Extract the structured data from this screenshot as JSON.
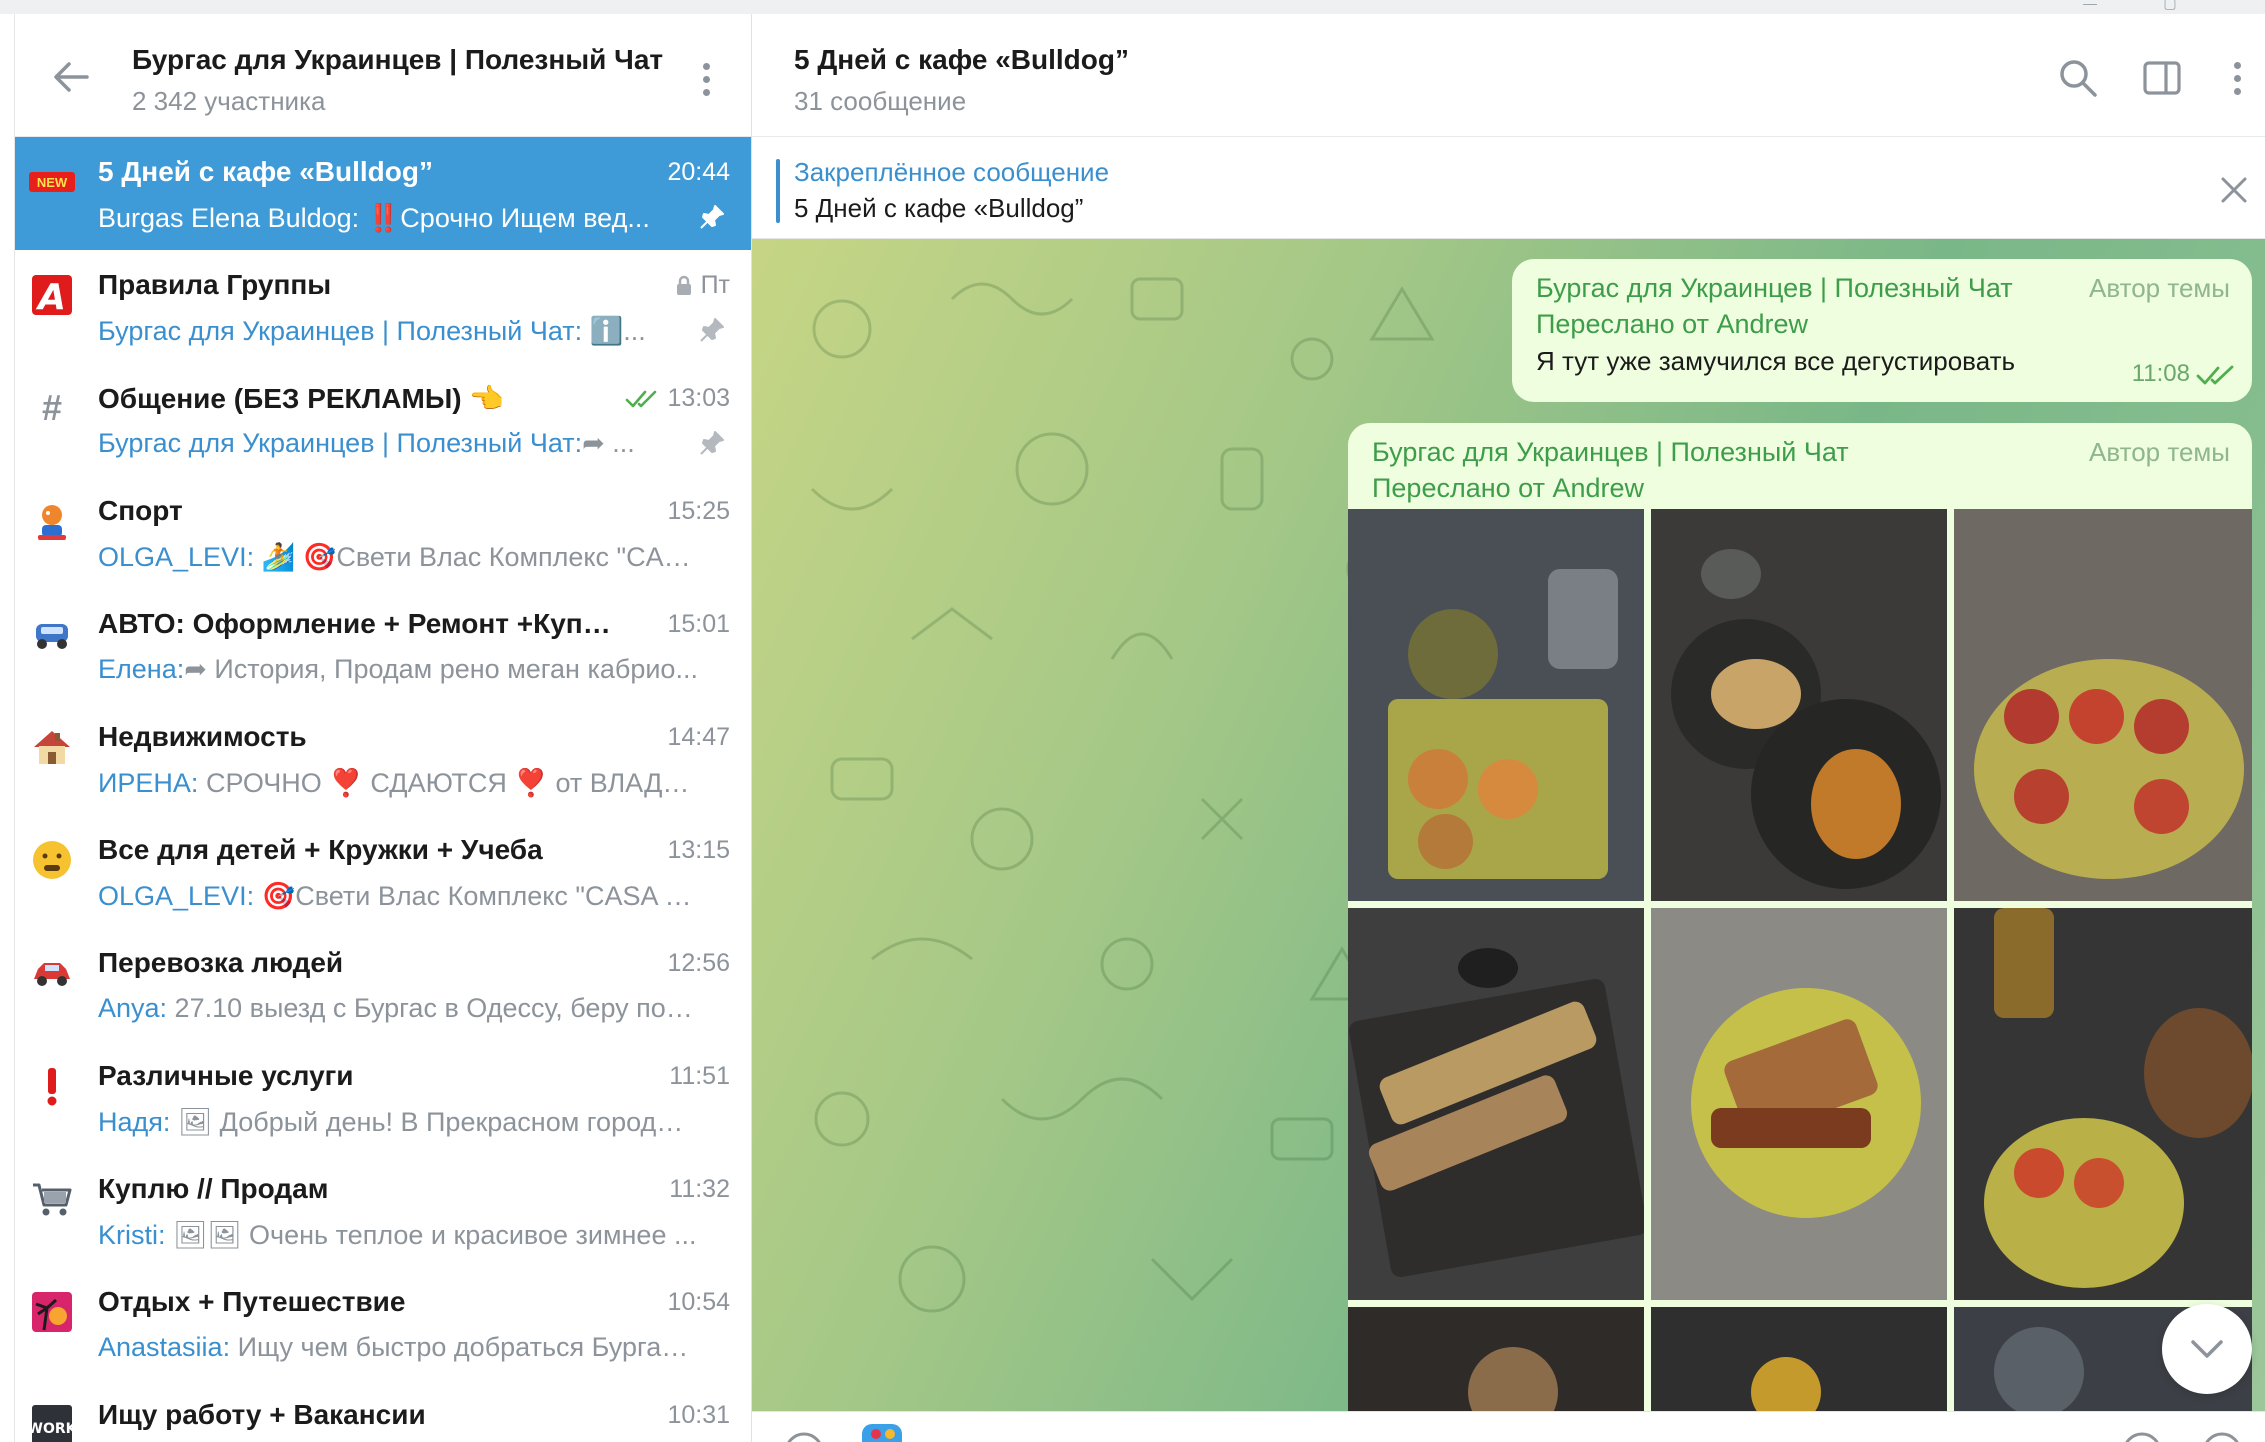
{
  "window": {
    "minimize": "—",
    "maximize": "▢"
  },
  "sidebar": {
    "title": "Бургас для Украинцев | Полезный Чат",
    "subtitle": "2 342 участника",
    "topics": [
      {
        "icon": "new-badge-icon",
        "name": "5 Дней с кафе «Bulldog”",
        "time": "20:44",
        "sender": "Burgas Elena Buldog:",
        "preview": " ‼️Срочно Ищем вед...",
        "pinned": true,
        "active": true
      },
      {
        "icon": "rules-a-icon",
        "name": "Правила Группы",
        "time": "Пт",
        "locked": true,
        "sender": "Бургас для Украинцев | Полезный Чат:",
        "preview": " ℹ️...",
        "pinned": true
      },
      {
        "icon": "hash-icon",
        "name": "Общение (БЕЗ РЕКЛАМЫ) 👈",
        "time": "13:03",
        "read": true,
        "sender": "Бургас для Украинцев | Полезный Чат:",
        "preview": "➦ ...",
        "pinned": true
      },
      {
        "icon": "sport-icon",
        "name": "Спорт",
        "time": "15:25",
        "sender": "OLGA_LEVI:",
        "preview": " 🏄 🎯Свети Влас  Комплекс \"CASA..."
      },
      {
        "icon": "car-icon",
        "name": "АВТО: Оформление + Ремонт +Куплю/...",
        "time": "15:01",
        "sender": "Елена:",
        "preview": "➦ История, Продам рено меган кабрио..."
      },
      {
        "icon": "house-icon",
        "name": "Недвижимость",
        "time": "14:47",
        "sender": "ИРЕНА:",
        "preview": " СРОЧНО ❣️ СДАЮТСЯ ❣️  от  ВЛАДЕЛЬ..."
      },
      {
        "icon": "face-icon",
        "name": "Все для детей + Кружки + Учеба",
        "time": "13:15",
        "sender": "OLGA_LEVI:",
        "preview": " 🎯Свети Влас  Комплекс \"CASA RE..."
      },
      {
        "icon": "red-car-icon",
        "name": "Перевозка людей",
        "time": "12:56",
        "sender": "Anya:",
        "preview": " 27.10 выезд  с Бургас в Одессу, беру пос..."
      },
      {
        "icon": "exclamation-icon",
        "name": "Различные услуги",
        "time": "11:51",
        "sender": "Надя:",
        "preview": " 🖼 Добрый день! В Прекрасном городе ..."
      },
      {
        "icon": "cart-icon",
        "name": "Куплю // Продам",
        "time": "11:32",
        "sender": "Kristi:",
        "preview": " 🖼🖼 Очень теплое и красивое зимнее ..."
      },
      {
        "icon": "palm-icon",
        "name": "Отдых + Путешествие",
        "time": "10:54",
        "sender": "Anastasiia:",
        "preview": " Ищу чем быстро добраться Бургас ..."
      },
      {
        "icon": "work-icon",
        "name": "Ищу работу + Вакансии",
        "time": "10:31",
        "sender": "",
        "preview": ""
      }
    ]
  },
  "main": {
    "title": "5 Дней с кафе «Bulldog”",
    "subtitle": "31 сообщение",
    "pinned": {
      "label": "Закреплённое сообщение",
      "text": "5 Дней с кафе «Bulldog”"
    },
    "messages": [
      {
        "from": "Бургас для Украинцев | Полезный Чат",
        "author_badge": "Автор темы",
        "forwarded": "Переслано от Andrew",
        "text": "Я тут уже замучился все дегустировать",
        "time": "11:08"
      },
      {
        "from": "Бургас для Украинцев | Полезный Чат",
        "author_badge": "Автор темы",
        "forwarded": "Переслано от Andrew",
        "photos": 9
      }
    ]
  },
  "colors": {
    "accent": "#3e9bd8",
    "bubble": "#eefedf",
    "sender_green": "#3e9d4a",
    "link_blue": "#3a8fcf"
  }
}
